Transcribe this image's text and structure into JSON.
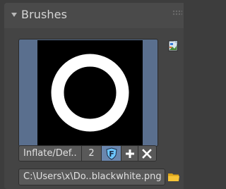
{
  "panel": {
    "title": "Brushes",
    "collapse_icon": "triangle-down",
    "grip_icon": "drag-dots"
  },
  "brush": {
    "name": "Inflate/Def..",
    "users": "2",
    "fake_user_label": "F",
    "preview_icon": "ring-circle",
    "browse_icon": "image-icon",
    "new_icon": "plus",
    "unlink_icon": "x-mark"
  },
  "texture": {
    "path": "C:\\Users\\x\\Do..blackwhite.png",
    "folder_icon": "folder"
  },
  "colors": {
    "background": "#3d3d3d",
    "preview_frame": "#5a6f8e",
    "fake_user_active": "#6a86ad",
    "field": "#595959",
    "text": "#e0e0e0"
  }
}
